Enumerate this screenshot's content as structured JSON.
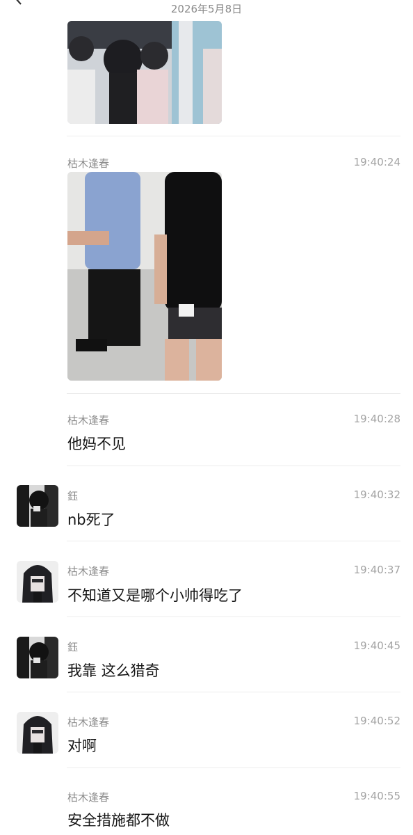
{
  "header": {
    "date": "2026年5月8日"
  },
  "messages": [
    {
      "sender": "",
      "time": "",
      "type": "image",
      "image": "crowd-photo"
    },
    {
      "sender": "枯木逢春",
      "time": "19:40:24",
      "type": "image",
      "image": "police-photo"
    },
    {
      "sender": "枯木逢春",
      "time": "19:40:28",
      "type": "text",
      "text": "他妈不见"
    },
    {
      "sender": "鈺",
      "time": "19:40:32",
      "type": "text",
      "text": "nb死了"
    },
    {
      "sender": "枯木逢春",
      "time": "19:40:37",
      "type": "text",
      "text": "不知道又是哪个小帅得吃了"
    },
    {
      "sender": "鈺",
      "time": "19:40:45",
      "type": "text",
      "text": "我靠 这么猎奇"
    },
    {
      "sender": "枯木逢春",
      "time": "19:40:52",
      "type": "text",
      "text": "对啊"
    },
    {
      "sender": "枯木逢春",
      "time": "19:40:55",
      "type": "text",
      "text": "安全措施都不做"
    }
  ],
  "colors": {
    "divider": "#ececec",
    "sender": "#8c8c8c",
    "time": "#a3a3a3"
  }
}
